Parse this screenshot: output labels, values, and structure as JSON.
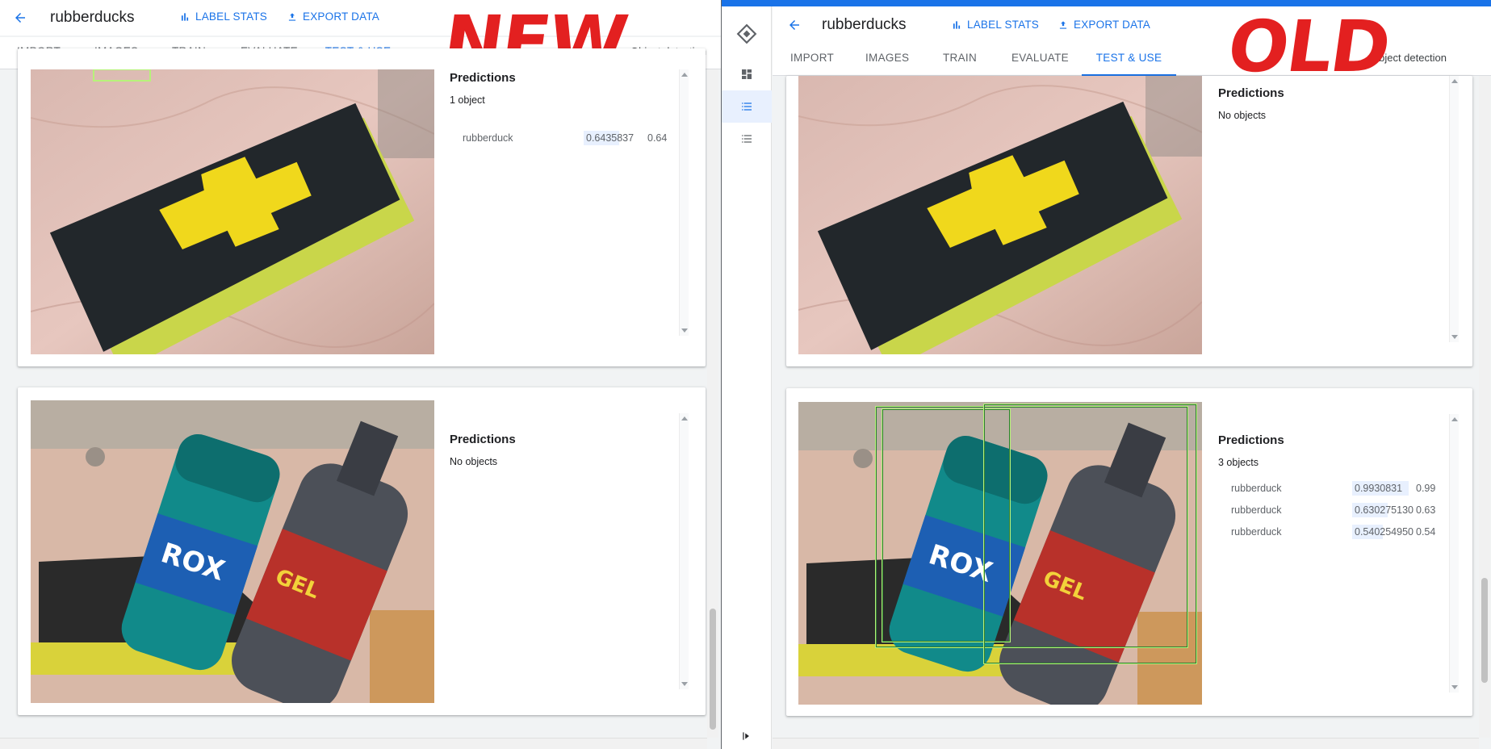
{
  "new_pane": {
    "annotation": "NEW",
    "header": {
      "title": "rubberducks",
      "label_stats": "LABEL STATS",
      "export_data": "EXPORT DATA"
    },
    "tabs": [
      "IMPORT",
      "IMAGES",
      "TRAIN",
      "EVALUATE",
      "TEST & USE"
    ],
    "active_tab": "TEST & USE",
    "model_type": "Object detection",
    "cards": [
      {
        "heading": "Predictions",
        "count": "1 object",
        "rows": [
          {
            "label": "rubberduck",
            "score": "0.6435837",
            "short": "0.64",
            "fill": 0.6435837
          }
        ]
      },
      {
        "heading": "Predictions",
        "count": "No objects",
        "rows": []
      }
    ]
  },
  "old_pane": {
    "annotation": "OLD",
    "header": {
      "title": "rubberducks",
      "label_stats": "LABEL STATS",
      "export_data": "EXPORT DATA"
    },
    "tabs": [
      "IMPORT",
      "IMAGES",
      "TRAIN",
      "EVALUATE",
      "TEST & USE"
    ],
    "active_tab": "TEST & USE",
    "model_type": "Object detection",
    "cards": [
      {
        "heading": "Predictions",
        "count": "No objects",
        "rows": []
      },
      {
        "heading": "Predictions",
        "count": "3 objects",
        "rows": [
          {
            "label": "rubberduck",
            "score": "0.9930831",
            "short": "0.99",
            "fill": 0.9930831
          },
          {
            "label": "rubberduck",
            "score": "0.630275130",
            "short": "0.63",
            "fill": 0.63027513
          },
          {
            "label": "rubberduck",
            "score": "0.540254950",
            "short": "0.54",
            "fill": 0.54025495
          }
        ]
      }
    ]
  },
  "icons": [
    "arrow-back-icon",
    "bar-chart-icon",
    "export-icon",
    "automl-logo-icon",
    "dashboard-icon",
    "list-icon",
    "expand-rail-icon"
  ],
  "colors": {
    "accent": "#1a73e8",
    "annotation": "#e32020",
    "bbox": "#b7f27a"
  }
}
